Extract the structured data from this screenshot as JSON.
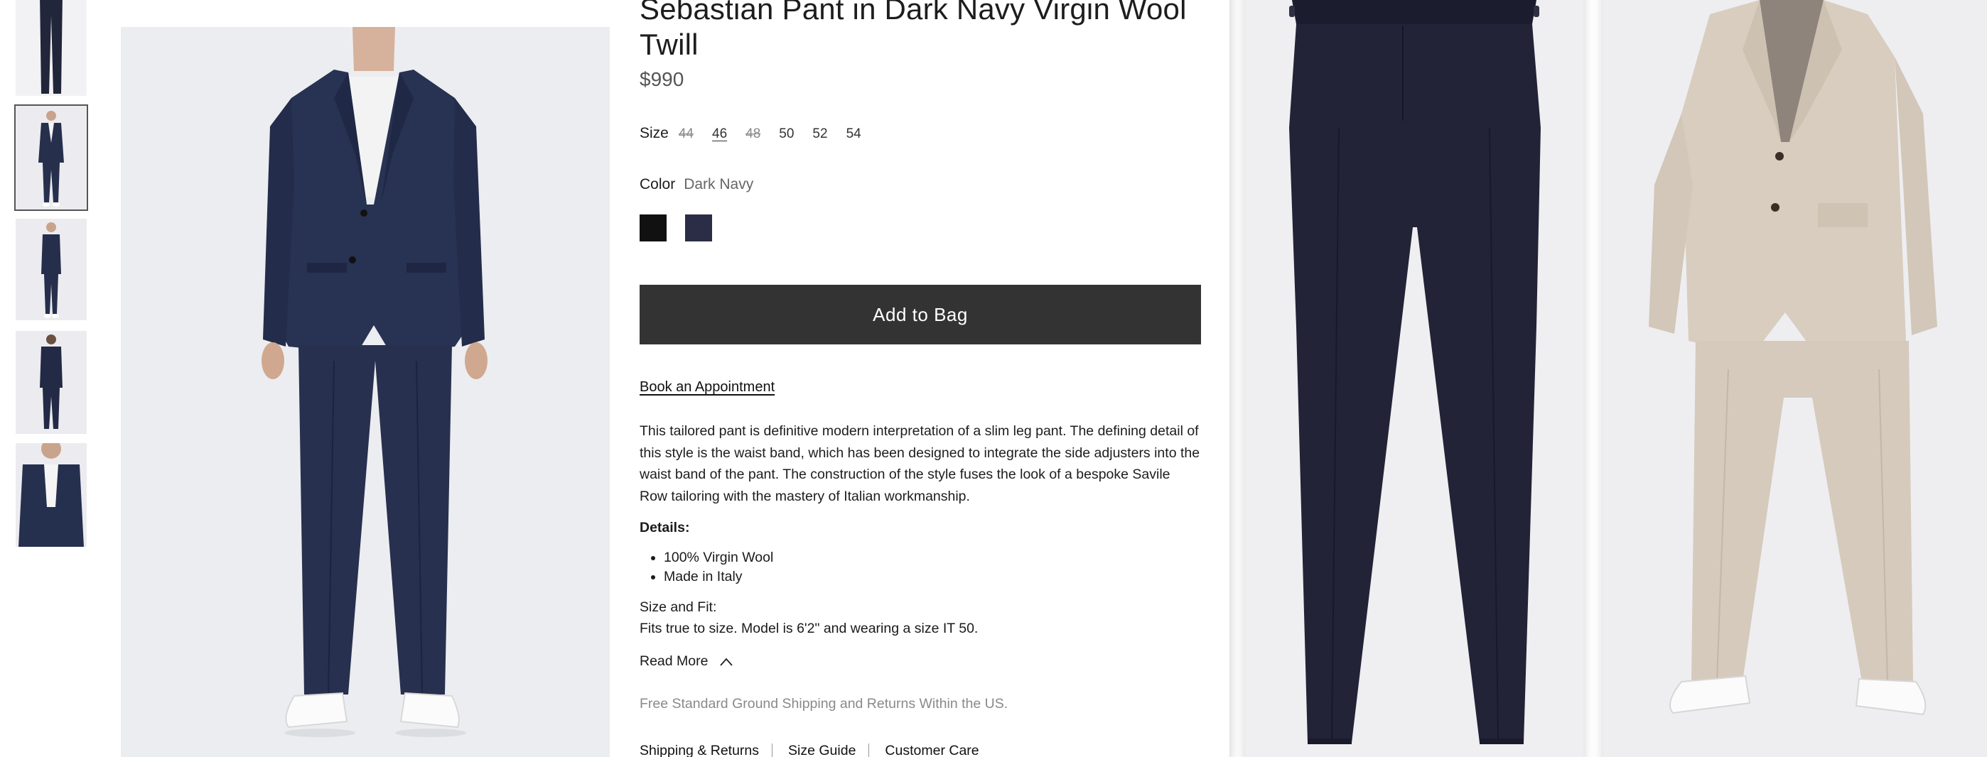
{
  "product": {
    "title": "Sebastian Pant in Dark Navy Virgin Wool Twill",
    "price": "$990"
  },
  "size": {
    "label": "Size",
    "options": [
      {
        "label": "44",
        "state": "unavailable"
      },
      {
        "label": "46",
        "state": "selected"
      },
      {
        "label": "48",
        "state": "unavailable"
      },
      {
        "label": "50",
        "state": "available"
      },
      {
        "label": "52",
        "state": "available"
      },
      {
        "label": "54",
        "state": "available"
      }
    ]
  },
  "color": {
    "label": "Color",
    "value": "Dark Navy",
    "swatches": [
      "#111111",
      "#2a2d45"
    ]
  },
  "actions": {
    "add_to_bag": "Add to Bag",
    "book_appointment": "Book an Appointment",
    "read_more": "Read More"
  },
  "description": "This tailored pant is definitive modern interpretation of a slim leg pant. The defining detail of this style is the waist band, which has been designed to integrate the side adjusters into the waist band of the pant. The construction of the style fuses the look of a bespoke Savile Row tailoring with the mastery of Italian workmanship.",
  "details": {
    "heading": "Details:",
    "items": [
      "100% Virgin Wool",
      "Made in Italy"
    ]
  },
  "fit": {
    "heading": "Size and Fit:",
    "text": "Fits true to size. Model is 6'2\" and wearing a size IT 50."
  },
  "shipping_note": "Free Standard Ground Shipping and Returns Within the US.",
  "footer_links": [
    "Shipping & Returns",
    "Size Guide",
    "Customer Care"
  ],
  "colors": {
    "navy": "#28314f",
    "button": "#333333",
    "beige": "#d8cfc3"
  }
}
